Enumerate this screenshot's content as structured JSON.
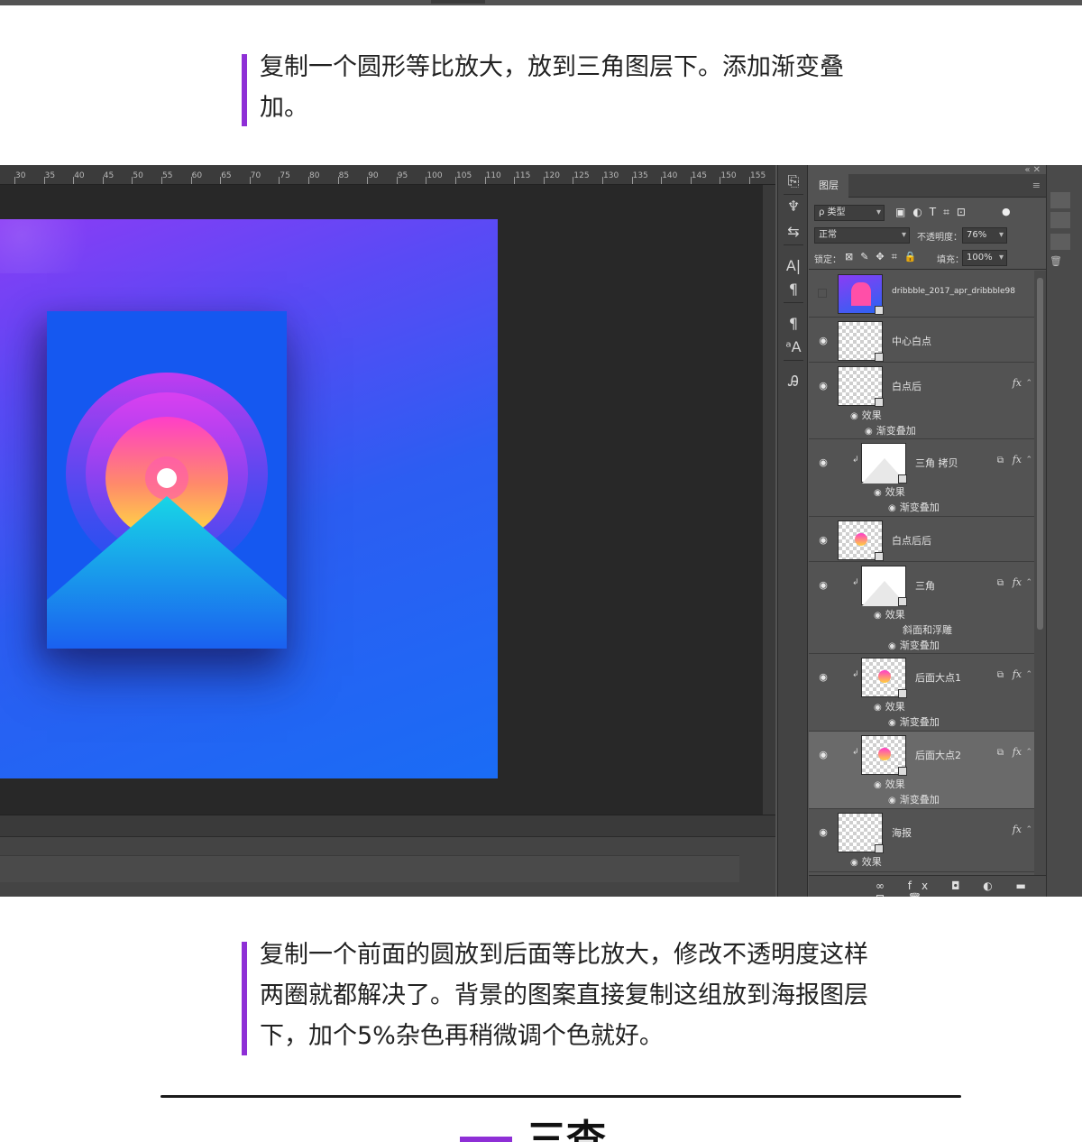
{
  "paragraph_top": "复制一个圆形等比放大，放到三角图层下。添加渐变叠加。",
  "paragraph_bottom": "复制一个前面的圆放到后面等比放大，修改不透明度这样两圈就都解决了。背景的图案直接复制这组放到海报图层下，加个5%杂色再稍微调个色就好。",
  "next_section_title": "三查",
  "colors": {
    "accent": "#8e2fd6",
    "ps_panel": "#535353",
    "canvas_bg": "#282828",
    "artboard_top": "#8a3cf5",
    "artboard_bottom": "#1a6cf5",
    "poster": "#1558f0"
  },
  "ruler_ticks": [
    "30",
    "35",
    "40",
    "45",
    "50",
    "55",
    "60",
    "65",
    "70",
    "75",
    "80",
    "85",
    "90",
    "95",
    "100",
    "105",
    "110",
    "115",
    "120",
    "125",
    "130",
    "135",
    "140",
    "145",
    "150",
    "155"
  ],
  "toolbar_icons": [
    "history-icon",
    "brush-preset-icon",
    "adjust-icon",
    "character-icon",
    "paragraph-icon",
    "paragraph-style-icon",
    "character-style-icon",
    "glyph-icon"
  ],
  "layers_panel": {
    "tab_label": "图层",
    "filter_label": "ρ 类型",
    "blend_mode": "正常",
    "opacity_label": "不透明度：",
    "opacity_value": "76%",
    "lock_label": "锁定：",
    "fill_label": "填充：",
    "fill_value": "100%",
    "layers": [
      {
        "name": "dribbble_2017_apr_dribbble98",
        "visible": false,
        "fx": false
      },
      {
        "name": "中心白点",
        "visible": true,
        "fx": false
      },
      {
        "name": "白点后",
        "visible": true,
        "fx": true,
        "effects_label": "效果",
        "effects": [
          "渐变叠加"
        ]
      },
      {
        "name": "三角 拷贝",
        "visible": true,
        "fx": true,
        "clipped": true,
        "effects_label": "效果",
        "effects": [
          "渐变叠加"
        ]
      },
      {
        "name": "白点后后",
        "visible": true,
        "fx": false
      },
      {
        "name": "三角",
        "visible": true,
        "fx": true,
        "clipped": true,
        "effects_label": "效果",
        "effects": [
          "斜面和浮雕",
          "渐变叠加"
        ]
      },
      {
        "name": "后面大点1",
        "visible": true,
        "fx": true,
        "clipped": true,
        "effects_label": "效果",
        "effects": [
          "渐变叠加"
        ]
      },
      {
        "name": "后面大点2",
        "visible": true,
        "fx": true,
        "clipped": true,
        "selected": true,
        "effects_label": "效果",
        "effects": [
          "渐变叠加"
        ]
      },
      {
        "name": "海报",
        "visible": true,
        "fx": true,
        "effects_label": "效果",
        "effects": []
      }
    ]
  }
}
